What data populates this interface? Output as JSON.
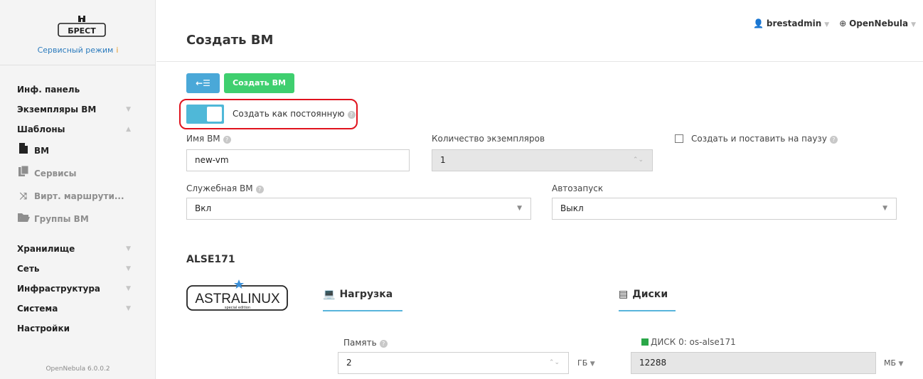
{
  "brand": {
    "service_mode": "Сервисный режим",
    "info_icon": "i",
    "logo_text": "БРЕСТ"
  },
  "sidebar": {
    "items": [
      {
        "label": "Инф. панель"
      },
      {
        "label": "Экземпляры ВМ"
      },
      {
        "label": "Шаблоны"
      }
    ],
    "template_subitems": [
      {
        "label": "ВМ",
        "icon": "file-icon"
      },
      {
        "label": "Сервисы",
        "icon": "files-icon"
      },
      {
        "label": "Вирт. маршрути...",
        "icon": "shuffle-icon"
      },
      {
        "label": "Группы ВМ",
        "icon": "folder-icon"
      }
    ],
    "lower_items": [
      {
        "label": "Хранилище"
      },
      {
        "label": "Сеть"
      },
      {
        "label": "Инфраструктура"
      },
      {
        "label": "Система"
      },
      {
        "label": "Настройки"
      }
    ],
    "version": "OpenNebula 6.0.0.2"
  },
  "topbar": {
    "user": "brestadmin",
    "zone": "OpenNebula"
  },
  "page": {
    "title": "Создать ВМ"
  },
  "toolbar": {
    "back_icon": "←☰",
    "create_label": "Создать ВМ"
  },
  "form": {
    "persistent_label": "Создать как постоянную",
    "vm_name_label": "Имя ВМ",
    "vm_name_value": "new-vm",
    "instances_label": "Количество экземпляров",
    "instances_value": "1",
    "hold_label": "Создать и поставить на паузу",
    "service_vm_label": "Служебная ВМ",
    "service_vm_value": "Вкл",
    "autostart_label": "Автозапуск",
    "autostart_value": "Выкл"
  },
  "template": {
    "name": "ALSE171",
    "logo_text": "ASTRALINUX",
    "logo_sub": "special edition",
    "tab_load": "Нагрузка",
    "tab_disks": "Диски",
    "memory_label": "Память",
    "memory_value": "2",
    "memory_unit": "ГБ",
    "disk_label": "ДИСК 0: os-alse171",
    "disk_value": "12288",
    "disk_unit": "МБ"
  },
  "colors": {
    "accent": "#4aa8d8",
    "create": "#3fcf6f",
    "highlight": "#e0131e"
  }
}
